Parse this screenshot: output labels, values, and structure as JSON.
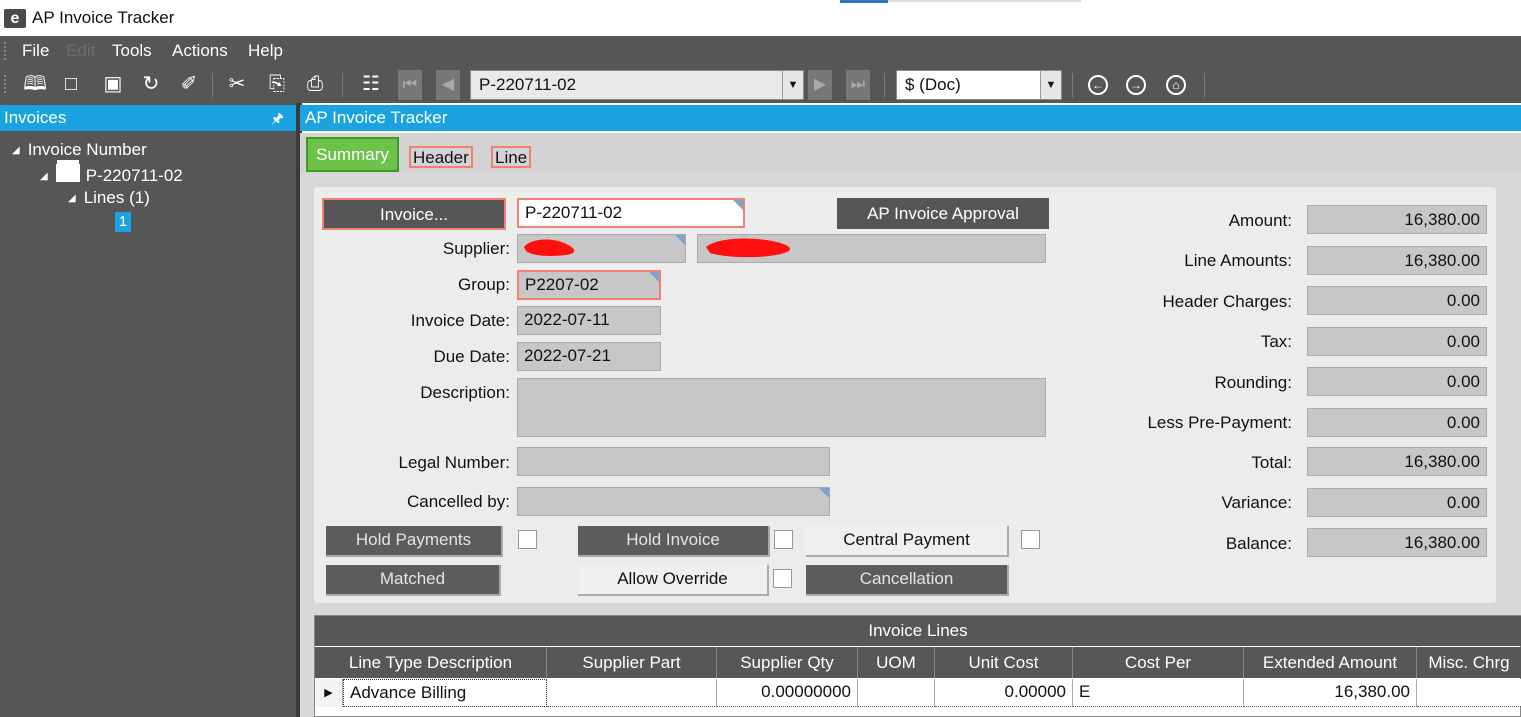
{
  "window": {
    "title": "AP Invoice Tracker",
    "logo_letter": "e"
  },
  "menu": {
    "items": [
      "File",
      "Edit",
      "Tools",
      "Actions",
      "Help"
    ]
  },
  "toolbar": {
    "nav_value": "P-220711-02",
    "currency_value": "$ (Doc)"
  },
  "left_panel": {
    "title": "Invoices",
    "tree": {
      "root": "Invoice Number",
      "invoice": "P-220711-02",
      "lines": "Lines (1)",
      "line_item": "1"
    }
  },
  "main": {
    "title": "AP Invoice Tracker",
    "tabs": {
      "summary": "Summary",
      "header": "Header",
      "line": "Line"
    }
  },
  "form": {
    "invoice_button": "Invoice...",
    "invoice_value": "P-220711-02",
    "approval_button": "AP Invoice Approval",
    "supplier_label": "Supplier:",
    "group_label": "Group:",
    "group_value": "P2207-02",
    "invoice_date_label": "Invoice Date:",
    "invoice_date_value": "2022-07-11",
    "due_date_label": "Due Date:",
    "due_date_value": "2022-07-21",
    "description_label": "Description:",
    "legal_number_label": "Legal Number:",
    "cancelled_by_label": "Cancelled by:",
    "hold_payments": "Hold Payments",
    "hold_invoice": "Hold Invoice",
    "central_payment": "Central Payment",
    "matched": "Matched",
    "allow_override": "Allow Override",
    "cancellation": "Cancellation"
  },
  "totals": {
    "amount_label": "Amount:",
    "amount": "16,380.00",
    "line_amounts_label": "Line Amounts:",
    "line_amounts": "16,380.00",
    "header_charges_label": "Header Charges:",
    "header_charges": "0.00",
    "tax_label": "Tax:",
    "tax": "0.00",
    "rounding_label": "Rounding:",
    "rounding": "0.00",
    "less_prepayment_label": "Less Pre-Payment:",
    "less_prepayment": "0.00",
    "total_label": "Total:",
    "total": "16,380.00",
    "variance_label": "Variance:",
    "variance": "0.00",
    "balance_label": "Balance:",
    "balance": "16,380.00"
  },
  "grid": {
    "title": "Invoice Lines",
    "columns": [
      "Line Type Description",
      "Supplier Part",
      "Supplier Qty",
      "UOM",
      "Unit Cost",
      "Cost Per",
      "Extended Amount",
      "Misc. Chrg"
    ],
    "rows": [
      {
        "line_type": "Advance Billing",
        "supplier_part": "",
        "supplier_qty": "0.00000000",
        "uom": "",
        "unit_cost": "0.00000",
        "cost_per": "E",
        "extended_amount": "16,380.00",
        "misc": ""
      }
    ]
  }
}
